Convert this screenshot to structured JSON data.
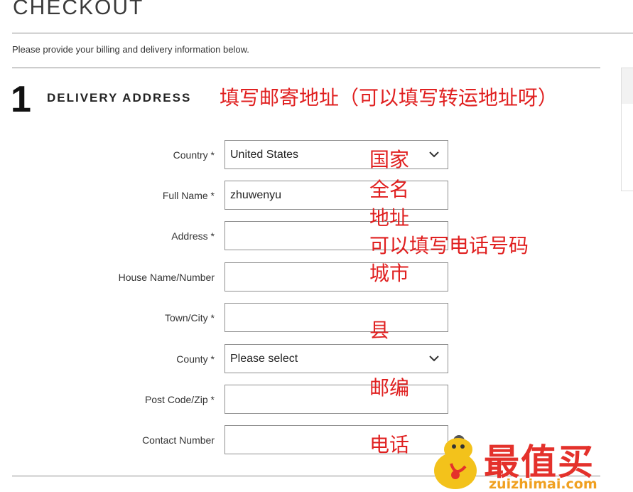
{
  "page": {
    "title": "CHECKOUT",
    "top_faded_text": "",
    "subtitle": "Please provide your billing and delivery information below."
  },
  "step": {
    "number": "1",
    "title": "DELIVERY ADDRESS",
    "annotation": "填写邮寄地址（可以填写转运地址呀）"
  },
  "fields": [
    {
      "label": "Country *",
      "value": "United States",
      "type": "select",
      "annotation": "国家"
    },
    {
      "label": "Full Name *",
      "value": "zhuwenyu",
      "type": "text",
      "annotation": "全名"
    },
    {
      "label": "Address *",
      "value": "",
      "type": "text",
      "annotation": "地址"
    },
    {
      "label": "House Name/Number",
      "value": "",
      "type": "text",
      "annotation": "可以填写电话号码"
    },
    {
      "label": "Town/City *",
      "value": "",
      "type": "text",
      "annotation": "城市"
    },
    {
      "label": "County *",
      "value": "Please select",
      "type": "select",
      "annotation": "县"
    },
    {
      "label": "Post Code/Zip *",
      "value": "",
      "type": "text",
      "annotation": "邮编"
    },
    {
      "label": "Contact Number",
      "value": "",
      "type": "text",
      "annotation": "电话"
    }
  ],
  "watermark": {
    "logo_text": "最值买",
    "url": "zuizhimai.com"
  },
  "colors": {
    "annotation": "#e02020",
    "border": "#8f8f8f",
    "logo_red": "#e4312b",
    "logo_orange": "#f0a020"
  }
}
